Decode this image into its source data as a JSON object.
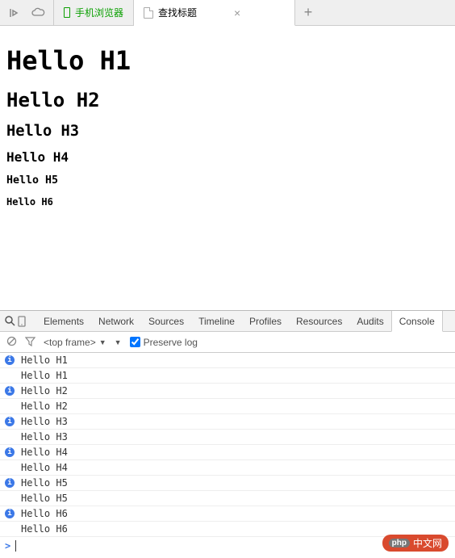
{
  "tabs": {
    "mobile_label": "手机浏览器",
    "active_label": "查找标题"
  },
  "page": {
    "h1": "Hello H1",
    "h2": "Hello H2",
    "h3": "Hello H3",
    "h4": "Hello H4",
    "h5": "Hello H5",
    "h6": "Hello H6"
  },
  "devtools": {
    "tabs": [
      "Elements",
      "Network",
      "Sources",
      "Timeline",
      "Profiles",
      "Resources",
      "Audits",
      "Console"
    ],
    "active_tab": "Console",
    "frame_label": "<top frame>",
    "preserve_log": "Preserve log",
    "console_lines": [
      {
        "type": "info",
        "text": "Hello H1"
      },
      {
        "type": "plain",
        "text": "Hello H1"
      },
      {
        "type": "info",
        "text": "Hello H2"
      },
      {
        "type": "plain",
        "text": "Hello H2"
      },
      {
        "type": "info",
        "text": "Hello H3"
      },
      {
        "type": "plain",
        "text": "Hello H3"
      },
      {
        "type": "info",
        "text": "Hello H4"
      },
      {
        "type": "plain",
        "text": "Hello H4"
      },
      {
        "type": "info",
        "text": "Hello H5"
      },
      {
        "type": "plain",
        "text": "Hello H5"
      },
      {
        "type": "info",
        "text": "Hello H6"
      },
      {
        "type": "plain",
        "text": "Hello H6"
      }
    ]
  },
  "watermark": {
    "php": "php",
    "text": "中文网"
  }
}
